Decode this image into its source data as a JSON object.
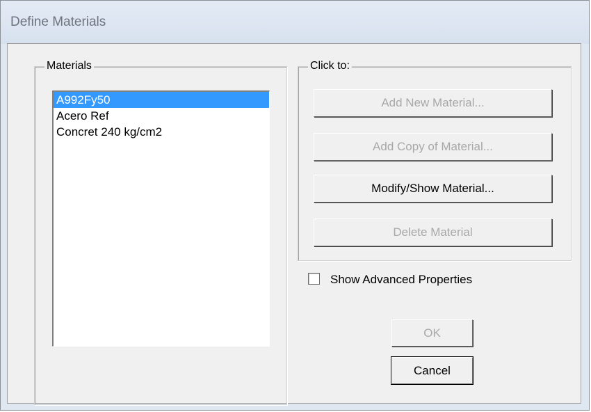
{
  "window": {
    "title": "Define Materials"
  },
  "materials": {
    "legend": "Materials",
    "items": [
      {
        "label": "A992Fy50",
        "selected": true
      },
      {
        "label": "Acero Ref",
        "selected": false
      },
      {
        "label": "Concret 240 kg/cm2",
        "selected": false
      }
    ]
  },
  "actions": {
    "legend": "Click to:",
    "add_new": "Add New Material...",
    "add_copy": "Add Copy of Material...",
    "modify_show": "Modify/Show Material...",
    "delete": "Delete Material"
  },
  "options": {
    "show_advanced_label": "Show Advanced Properties",
    "show_advanced_checked": false
  },
  "footer": {
    "ok_label": "OK",
    "cancel_label": "Cancel"
  },
  "colors": {
    "selection": "#3399ff",
    "dialog_bg": "#f0f0f0",
    "title_bg": "#dfe7f1"
  }
}
